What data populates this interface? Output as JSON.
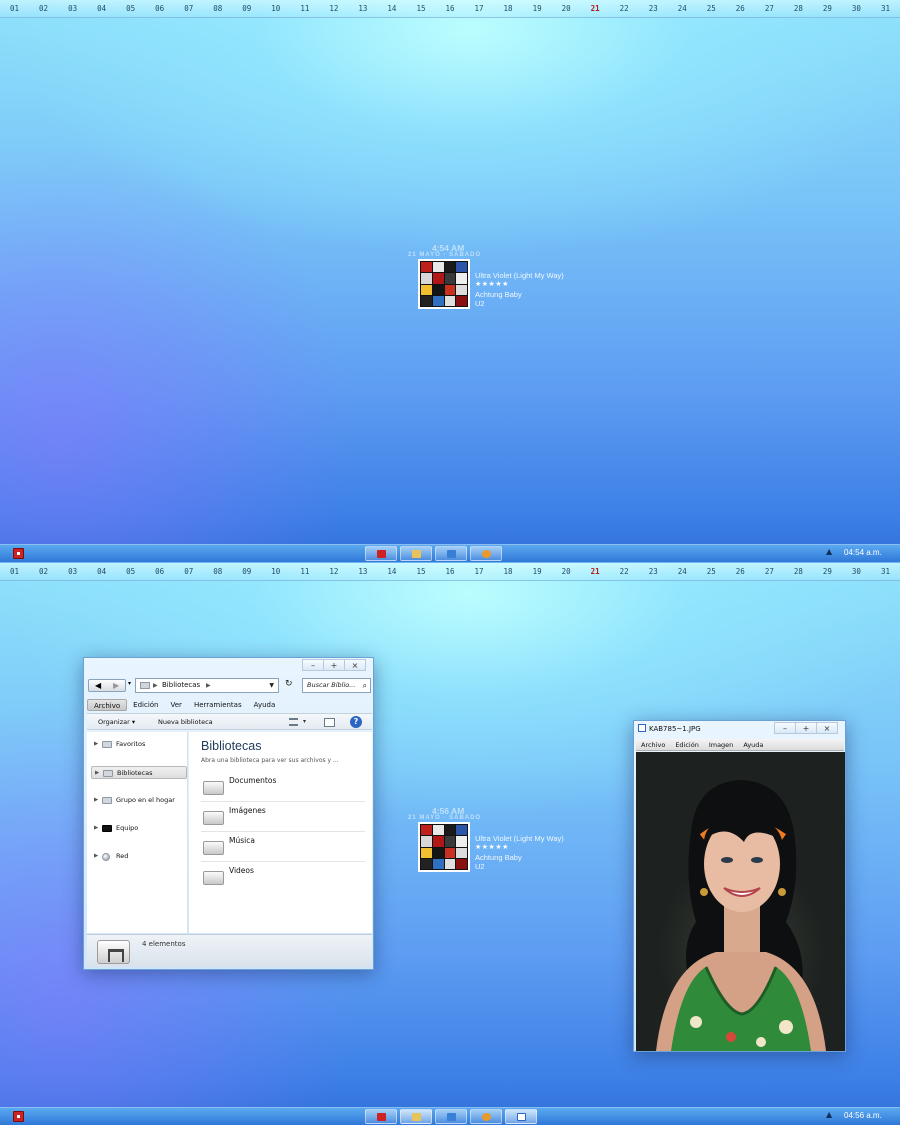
{
  "date_bar": {
    "days": [
      "01",
      "02",
      "03",
      "04",
      "05",
      "06",
      "07",
      "08",
      "09",
      "10",
      "11",
      "12",
      "13",
      "14",
      "15",
      "16",
      "17",
      "18",
      "19",
      "20",
      "21",
      "22",
      "23",
      "24",
      "25",
      "26",
      "27",
      "28",
      "29",
      "30",
      "31"
    ],
    "today": "21",
    "today_color": "#b31a1a"
  },
  "now_playing": {
    "date_line": "21 MAYO · SABADO",
    "title": "Ultra Violet (Light My Way)",
    "rating": "★★★★★",
    "album": "Achtung Baby",
    "artist": "U2"
  },
  "screens": [
    {
      "time_widget": "4:54 AM",
      "clock": "04:54 a.m."
    },
    {
      "time_widget": "4:56 AM",
      "clock": "04:56 a.m."
    }
  ],
  "taskbar": {
    "tray_icon": "up-arrow-icon",
    "buttons": [
      "media-player",
      "file-explorer",
      "windows-store",
      "settings"
    ],
    "buttons_screen2_extra": "photo-viewer"
  },
  "explorer": {
    "caption": {
      "minimize": "–",
      "maximize": "+",
      "close": "×"
    },
    "address": "Bibliotecas",
    "search_placeholder": "Buscar Biblio...",
    "menu": [
      "Archivo",
      "Edición",
      "Ver",
      "Herramientas",
      "Ayuda"
    ],
    "toolbar": {
      "organize": "Organizar ▾",
      "new_library": "Nueva biblioteca"
    },
    "nav": [
      {
        "label": "Favoritos",
        "icon": "star-folder-icon"
      },
      {
        "label": "Bibliotecas",
        "icon": "library-icon"
      },
      {
        "label": "Grupo en el hogar",
        "icon": "homegroup-icon"
      },
      {
        "label": "Equipo",
        "icon": "computer-icon"
      },
      {
        "label": "Red",
        "icon": "network-icon"
      }
    ],
    "content": {
      "title": "Bibliotecas",
      "subtitle": "Abra una biblioteca para ver sus archivos y ...",
      "libraries": [
        "Documentos",
        "Imágenes",
        "Música",
        "Videos"
      ]
    },
    "details": "4 elementos"
  },
  "viewer": {
    "title": "KAB785~1.JPG",
    "menu": [
      "Archivo",
      "Edición",
      "Imagen",
      "Ayuda"
    ],
    "caption": {
      "minimize": "–",
      "maximize": "+",
      "close": "×"
    }
  }
}
